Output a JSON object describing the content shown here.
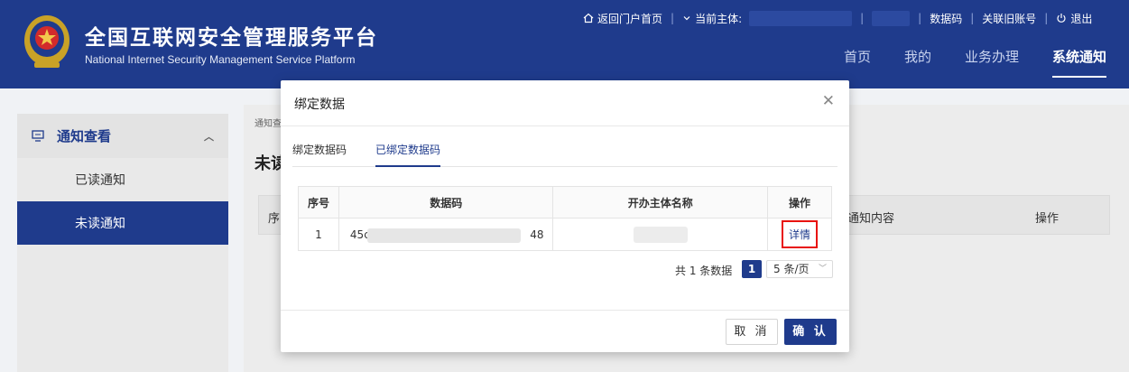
{
  "header": {
    "title": "全国互联网安全管理服务平台",
    "subtitle": "National Internet Security Management Service Platform",
    "toplinks": {
      "home_portal": "返回门户首页",
      "current_subject_label": "当前主体:",
      "data_code": "数据码",
      "link_old_account": "关联旧账号",
      "logout": "退出"
    },
    "nav": [
      {
        "label": "首页"
      },
      {
        "label": "我的"
      },
      {
        "label": "业务办理"
      },
      {
        "label": "系统通知"
      }
    ],
    "colors": {
      "brand": "#1f3b8c",
      "highlight": "#e8120f"
    }
  },
  "sidebar": {
    "group_label": "通知查看",
    "items": [
      {
        "label": "已读通知"
      },
      {
        "label": "未读通知"
      }
    ]
  },
  "content": {
    "breadcrumb": "通知查",
    "title": "未读",
    "table_headers": {
      "index": "序",
      "content": "通知内容",
      "action": "操作"
    }
  },
  "modal": {
    "title": "绑定数据",
    "tabs": [
      {
        "label": "绑定数据码"
      },
      {
        "label": "已绑定数据码"
      }
    ],
    "table": {
      "headers": [
        "序号",
        "数据码",
        "开办主体名称",
        "操作"
      ],
      "rows": [
        {
          "index": "1",
          "code_prefix": "45c",
          "code_suffix": "48",
          "action": "详情"
        }
      ]
    },
    "pagination": {
      "total_text": "共 1 条数据",
      "current_page": "1",
      "page_size": "5 条/页"
    },
    "buttons": {
      "cancel": "取 消",
      "confirm": "确 认"
    }
  }
}
